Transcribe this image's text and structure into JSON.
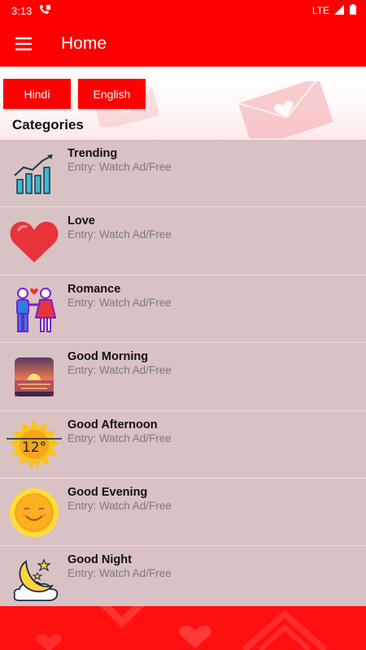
{
  "status_bar": {
    "time": "3:13",
    "network": "LTE"
  },
  "app_bar": {
    "title": "Home",
    "menu_icon": "hamburger-menu-icon"
  },
  "language_buttons": {
    "hindi": "Hindi",
    "english": "English"
  },
  "categories_heading": "Categories",
  "categories": [
    {
      "title": "Trending",
      "subtitle": "Entry: Watch Ad/Free",
      "icon": "trending-chart-icon"
    },
    {
      "title": "Love",
      "subtitle": "Entry: Watch Ad/Free",
      "icon": "heart-icon"
    },
    {
      "title": "Romance",
      "subtitle": "Entry: Watch Ad/Free",
      "icon": "couple-icon"
    },
    {
      "title": "Good Morning",
      "subtitle": "Entry: Watch Ad/Free",
      "icon": "sunrise-icon"
    },
    {
      "title": "Good Afternoon",
      "subtitle": "Entry: Watch Ad/Free",
      "icon": "sun-temperature-icon"
    },
    {
      "title": "Good Evening",
      "subtitle": "Entry: Watch Ad/Free",
      "icon": "smiling-sun-icon"
    },
    {
      "title": "Good Night",
      "subtitle": "Entry: Watch Ad/Free",
      "icon": "moon-stars-icon"
    }
  ],
  "colors": {
    "primary": "#ff0000",
    "list_background": "#d9c2c4",
    "subtitle": "#7a7a7a"
  },
  "afternoon_temperature": "12°"
}
